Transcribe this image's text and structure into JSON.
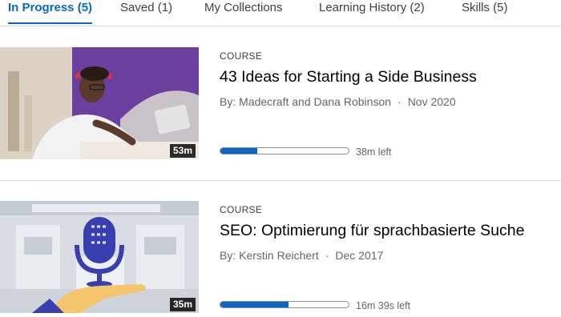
{
  "tabs": [
    {
      "label": "In Progress (5)",
      "active": true
    },
    {
      "label": "Saved (1)",
      "active": false
    },
    {
      "label": "My Collections",
      "active": false
    },
    {
      "label": "Learning History (2)",
      "active": false
    },
    {
      "label": "Skills (5)",
      "active": false
    }
  ],
  "courses": [
    {
      "type": "COURSE",
      "title": "43 Ideas for Starting a Side Business",
      "author": "By: Madecraft and Dana Robinson",
      "date": "Nov 2020",
      "duration": "53m",
      "progress": 0.29,
      "time_left": "38m left"
    },
    {
      "type": "COURSE",
      "title": "SEO: Optimierung für sprachbasierte Suche",
      "author": "By: Kerstin Reichert",
      "date": "Dec 2017",
      "duration": "35m",
      "progress": 0.53,
      "time_left": "16m 39s left"
    }
  ],
  "colors": {
    "accent": "#0a66c2"
  },
  "icons": [
    "microphone-icon"
  ]
}
